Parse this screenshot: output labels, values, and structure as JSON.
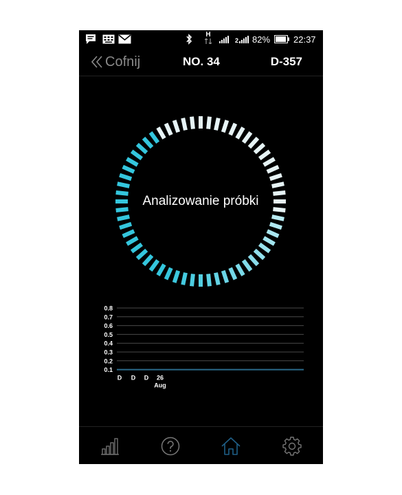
{
  "status_bar": {
    "icons": [
      "message-icon",
      "keyboard-icon",
      "mail-icon",
      "bluetooth-icon",
      "hspa-data-icon",
      "signal-icon",
      "signal-icon",
      "battery-icon"
    ],
    "network_label": "H",
    "battery": "82%",
    "time": "22:37"
  },
  "header": {
    "back_label": "Cofnij",
    "number": "NO. 34",
    "device_id": "D-357"
  },
  "progress": {
    "label": "Analizowanie próbki",
    "fraction_active": 0.65,
    "active_color": "#34c6dd",
    "inactive_color": "#e6f3f5"
  },
  "chart_data": {
    "type": "line",
    "y_ticks": [
      "0.8",
      "0.7",
      "0.6",
      "0.5",
      "0.4",
      "0.3",
      "0.2",
      "0.1"
    ],
    "ylim": [
      0.1,
      0.8
    ],
    "x_labels": [
      "D",
      "D",
      "D",
      "26"
    ],
    "x_sublabel": "Aug",
    "series": [
      {
        "values": [
          0.1,
          0.1,
          0.1,
          0.1
        ],
        "color": "#2a6a8a"
      }
    ],
    "grid": true
  },
  "bottom_nav": {
    "items": [
      {
        "icon": "bar-chart-icon",
        "active": false
      },
      {
        "icon": "help-icon",
        "active": false
      },
      {
        "icon": "home-icon",
        "active": true
      },
      {
        "icon": "gear-icon",
        "active": false
      }
    ],
    "active_color": "#1f5f87",
    "inactive_color": "#777777"
  }
}
